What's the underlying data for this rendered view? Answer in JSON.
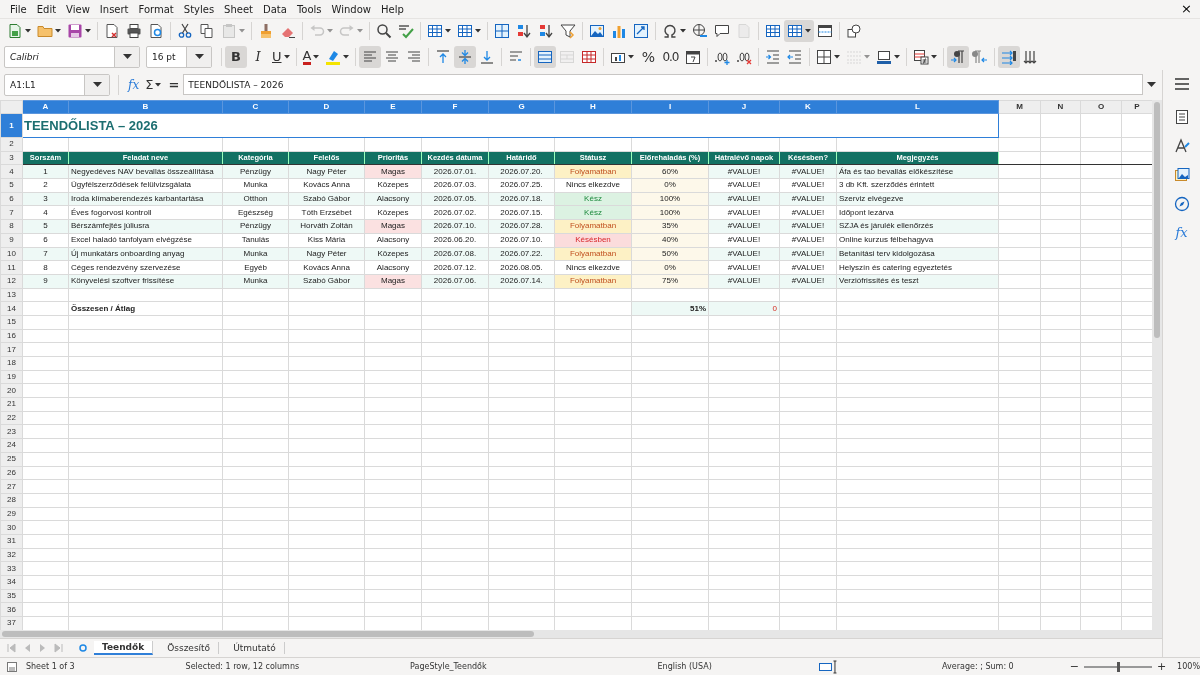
{
  "menu": [
    "File",
    "Edit",
    "View",
    "Insert",
    "Format",
    "Styles",
    "Sheet",
    "Data",
    "Tools",
    "Window",
    "Help"
  ],
  "close_document": "×",
  "standard_toolbar": [
    [
      {
        "kind": "new",
        "disabled": false,
        "on": false
      },
      {
        "kind": "open",
        "disabled": false,
        "on": false
      },
      {
        "kind": "save",
        "disabled": false,
        "on": false
      }
    ],
    [
      {
        "kind": "pdf",
        "disabled": false,
        "on": false
      },
      {
        "kind": "print",
        "disabled": false,
        "on": false
      },
      {
        "kind": "preview",
        "disabled": false,
        "on": false
      }
    ],
    [
      {
        "kind": "cut",
        "disabled": false,
        "on": false
      },
      {
        "kind": "copy",
        "disabled": false,
        "on": false
      },
      {
        "kind": "paste",
        "disabled": true,
        "on": false
      }
    ],
    [
      {
        "kind": "clone",
        "disabled": false,
        "on": false
      },
      {
        "kind": "clear",
        "disabled": false,
        "on": false
      }
    ],
    [
      {
        "kind": "undo",
        "disabled": true,
        "on": false
      },
      {
        "kind": "redo",
        "disabled": true,
        "on": false
      }
    ],
    [
      {
        "kind": "find",
        "disabled": false,
        "on": false
      },
      {
        "kind": "spell",
        "disabled": false,
        "on": false
      }
    ],
    [
      {
        "kind": "rows",
        "disabled": false,
        "on": false
      },
      {
        "kind": "columns",
        "disabled": false,
        "on": false
      }
    ],
    [
      {
        "kind": "sort",
        "disabled": false,
        "on": false
      },
      {
        "kind": "asc",
        "disabled": false,
        "on": false
      },
      {
        "kind": "desc",
        "disabled": false,
        "on": false
      },
      {
        "kind": "filter",
        "disabled": false,
        "on": false
      }
    ],
    [
      {
        "kind": "image",
        "disabled": false,
        "on": false
      },
      {
        "kind": "chart",
        "disabled": false,
        "on": false
      },
      {
        "kind": "pivot",
        "disabled": false,
        "on": false
      }
    ],
    [
      {
        "kind": "special",
        "disabled": false,
        "on": false
      },
      {
        "kind": "link",
        "disabled": false,
        "on": false
      },
      {
        "kind": "comment",
        "disabled": false,
        "on": false
      },
      {
        "kind": "headerfooter",
        "disabled": true,
        "on": false
      }
    ],
    [
      {
        "kind": "printarea",
        "disabled": false,
        "on": false
      },
      {
        "kind": "freeze",
        "disabled": false,
        "on": true
      },
      {
        "kind": "split",
        "disabled": false,
        "on": false
      }
    ],
    [
      {
        "kind": "draw",
        "disabled": false,
        "on": false
      }
    ]
  ],
  "formatting_toolbar": {
    "font_name": "Calibri",
    "font_size": "16 pt",
    "groups": [
      [
        {
          "kind": "bold",
          "label": "B",
          "disabled": false,
          "on": true
        },
        {
          "kind": "italic",
          "label": "I",
          "disabled": false,
          "on": false
        },
        {
          "kind": "underline",
          "label": "U",
          "disabled": false,
          "on": false
        }
      ],
      [
        {
          "kind": "fontcolor",
          "label": "A",
          "disabled": false,
          "on": false
        },
        {
          "kind": "highlight",
          "disabled": false,
          "on": false
        }
      ],
      [
        {
          "kind": "alignleft",
          "disabled": false,
          "on": true
        },
        {
          "kind": "aligncenter",
          "disabled": false,
          "on": false
        },
        {
          "kind": "alignright",
          "disabled": false,
          "on": false
        }
      ],
      [
        {
          "kind": "aligntop",
          "disabled": false,
          "on": false
        },
        {
          "kind": "alignmiddle",
          "disabled": false,
          "on": true
        },
        {
          "kind": "alignbottom",
          "disabled": false,
          "on": false
        }
      ],
      [
        {
          "kind": "wrap",
          "disabled": false,
          "on": false
        }
      ],
      [
        {
          "kind": "merge",
          "disabled": false,
          "on": true
        },
        {
          "kind": "unmerge",
          "disabled": true,
          "on": false
        },
        {
          "kind": "splitcells",
          "disabled": false,
          "on": false
        }
      ],
      [
        {
          "kind": "numberformat",
          "disabled": false,
          "on": false
        },
        {
          "kind": "percent",
          "label": "%",
          "disabled": false,
          "on": false
        },
        {
          "kind": "standard",
          "label": "0.0",
          "disabled": false,
          "on": false
        },
        {
          "kind": "date",
          "disabled": false,
          "on": false
        }
      ],
      [
        {
          "kind": "adddecimal",
          "disabled": false,
          "on": false
        },
        {
          "kind": "deldecimal",
          "disabled": false,
          "on": false
        }
      ],
      [
        {
          "kind": "indent",
          "disabled": false,
          "on": false
        },
        {
          "kind": "outdent",
          "disabled": false,
          "on": false
        }
      ],
      [
        {
          "kind": "borders",
          "disabled": false,
          "on": false
        },
        {
          "kind": "borderstyle",
          "disabled": true,
          "on": false
        },
        {
          "kind": "bordercolor",
          "disabled": false,
          "on": false
        }
      ],
      [
        {
          "kind": "conditional",
          "disabled": false,
          "on": false
        }
      ],
      [
        {
          "kind": "ltr",
          "disabled": false,
          "on": true
        },
        {
          "kind": "rtl",
          "disabled": false,
          "on": false
        }
      ],
      [
        {
          "kind": "textorient",
          "disabled": false,
          "on": true
        },
        {
          "kind": "verticaltext",
          "disabled": false,
          "on": false
        }
      ]
    ]
  },
  "formula_bar": {
    "name_box": "A1:L1",
    "function_wizard": "fx",
    "sum": "Σ",
    "equals": "=",
    "content": "TEENDŐLISTA – 2026"
  },
  "sidebar": {
    "functions": "fx"
  },
  "sheet": {
    "column_headers": [
      {
        "label": "A",
        "selected": true
      },
      {
        "label": "B",
        "selected": true
      },
      {
        "label": "C",
        "selected": true
      },
      {
        "label": "D",
        "selected": true
      },
      {
        "label": "E",
        "selected": true
      },
      {
        "label": "F",
        "selected": true
      },
      {
        "label": "G",
        "selected": true
      },
      {
        "label": "H",
        "selected": true
      },
      {
        "label": "I",
        "selected": true
      },
      {
        "label": "J",
        "selected": true
      },
      {
        "label": "K",
        "selected": true
      },
      {
        "label": "L",
        "selected": true
      },
      {
        "label": "M",
        "selected": false
      },
      {
        "label": "N",
        "selected": false
      },
      {
        "label": "O",
        "selected": false
      },
      {
        "label": "P",
        "selected": false
      }
    ],
    "row_numbers": [
      {
        "label": "1",
        "selected": true
      },
      {
        "label": "2",
        "selected": false
      },
      {
        "label": "3",
        "selected": false
      },
      {
        "label": "4",
        "selected": false
      },
      {
        "label": "5",
        "selected": false
      },
      {
        "label": "6",
        "selected": false
      },
      {
        "label": "7",
        "selected": false
      },
      {
        "label": "8",
        "selected": false
      },
      {
        "label": "9",
        "selected": false
      },
      {
        "label": "10",
        "selected": false
      },
      {
        "label": "11",
        "selected": false
      },
      {
        "label": "12",
        "selected": false
      },
      {
        "label": "13",
        "selected": false
      },
      {
        "label": "14",
        "selected": false
      },
      {
        "label": "15",
        "selected": false
      },
      {
        "label": "16",
        "selected": false
      },
      {
        "label": "17",
        "selected": false
      },
      {
        "label": "18",
        "selected": false
      },
      {
        "label": "19",
        "selected": false
      },
      {
        "label": "20",
        "selected": false
      },
      {
        "label": "21",
        "selected": false
      },
      {
        "label": "22",
        "selected": false
      },
      {
        "label": "23",
        "selected": false
      },
      {
        "label": "24",
        "selected": false
      },
      {
        "label": "25",
        "selected": false
      },
      {
        "label": "26",
        "selected": false
      },
      {
        "label": "27",
        "selected": false
      },
      {
        "label": "28",
        "selected": false
      },
      {
        "label": "29",
        "selected": false
      },
      {
        "label": "30",
        "selected": false
      },
      {
        "label": "31",
        "selected": false
      },
      {
        "label": "32",
        "selected": false
      },
      {
        "label": "33",
        "selected": false
      },
      {
        "label": "34",
        "selected": false
      },
      {
        "label": "35",
        "selected": false
      },
      {
        "label": "36",
        "selected": false
      },
      {
        "label": "37",
        "selected": false
      }
    ],
    "title": "TEENDŐLISTA – 2026",
    "table_header": [
      "Sorszám",
      "Feladat neve",
      "Kategória",
      "Felelős",
      "Prioritás",
      "Kezdés dátuma",
      "Határidő",
      "Státusz",
      "Előrehaladás (%)",
      "Hátralévő napok",
      "Késésben?",
      "Megjegyzés"
    ],
    "tasks": [
      {
        "no": "1",
        "task": "Negyedéves NAV bevallás összeállítása",
        "category": "Pénzügy",
        "owner": "Nagy Péter",
        "priority": {
          "text": "Magas",
          "kind": "high"
        },
        "start": "2026.07.01.",
        "due": "2026.07.20.",
        "status": {
          "text": "Folyamatban",
          "kind": "in_progress"
        },
        "progress": "60%",
        "days_left": "#VALUE!",
        "late": "#VALUE!",
        "note": "Áfa és tao bevallás előkészítése"
      },
      {
        "no": "2",
        "task": "Ügyfélszerződések felülvizsgálata",
        "category": "Munka",
        "owner": "Kovács Anna",
        "priority": {
          "text": "Közepes",
          "kind": "medium"
        },
        "start": "2026.07.03.",
        "due": "2026.07.25.",
        "status": {
          "text": "Nincs elkezdve",
          "kind": "not_started"
        },
        "progress": "0%",
        "days_left": "#VALUE!",
        "late": "#VALUE!",
        "note": "3 db Kft. szerződés érintett"
      },
      {
        "no": "3",
        "task": "Iroda klímaberendezés karbantartása",
        "category": "Otthon",
        "owner": "Szabó Gábor",
        "priority": {
          "text": "Alacsony",
          "kind": "low"
        },
        "start": "2026.07.05.",
        "due": "2026.07.18.",
        "status": {
          "text": "Kész",
          "kind": "done"
        },
        "progress": "100%",
        "days_left": "#VALUE!",
        "late": "#VALUE!",
        "note": "Szerviz elvégezve"
      },
      {
        "no": "4",
        "task": "Éves fogorvosi kontroll",
        "category": "Egészség",
        "owner": "Tóth Erzsébet",
        "priority": {
          "text": "Közepes",
          "kind": "medium"
        },
        "start": "2026.07.02.",
        "due": "2026.07.15.",
        "status": {
          "text": "Kész",
          "kind": "done"
        },
        "progress": "100%",
        "days_left": "#VALUE!",
        "late": "#VALUE!",
        "note": "Időpont lezárva"
      },
      {
        "no": "5",
        "task": "Bérszámfejtés júliusra",
        "category": "Pénzügy",
        "owner": "Horváth Zoltán",
        "priority": {
          "text": "Magas",
          "kind": "high"
        },
        "start": "2026.07.10.",
        "due": "2026.07.28.",
        "status": {
          "text": "Folyamatban",
          "kind": "in_progress"
        },
        "progress": "35%",
        "days_left": "#VALUE!",
        "late": "#VALUE!",
        "note": "SZJA és járulék ellenőrzés"
      },
      {
        "no": "6",
        "task": "Excel haladó tanfolyam elvégzése",
        "category": "Tanulás",
        "owner": "Kiss Mária",
        "priority": {
          "text": "Alacsony",
          "kind": "low"
        },
        "start": "2026.06.20.",
        "due": "2026.07.10.",
        "status": {
          "text": "Késésben",
          "kind": "late"
        },
        "progress": "40%",
        "days_left": "#VALUE!",
        "late": "#VALUE!",
        "note": "Online kurzus félbehagyva"
      },
      {
        "no": "7",
        "task": "Új munkatárs onboarding anyag",
        "category": "Munka",
        "owner": "Nagy Péter",
        "priority": {
          "text": "Közepes",
          "kind": "medium"
        },
        "start": "2026.07.08.",
        "due": "2026.07.22.",
        "status": {
          "text": "Folyamatban",
          "kind": "in_progress"
        },
        "progress": "50%",
        "days_left": "#VALUE!",
        "late": "#VALUE!",
        "note": "Betanítási terv kidolgozása"
      },
      {
        "no": "8",
        "task": "Céges rendezvény szervezése",
        "category": "Egyéb",
        "owner": "Kovács Anna",
        "priority": {
          "text": "Alacsony",
          "kind": "low"
        },
        "start": "2026.07.12.",
        "due": "2026.08.05.",
        "status": {
          "text": "Nincs elkezdve",
          "kind": "not_started"
        },
        "progress": "0%",
        "days_left": "#VALUE!",
        "late": "#VALUE!",
        "note": "Helyszín és catering egyeztetés"
      },
      {
        "no": "9",
        "task": "Könyvelési szoftver frissítése",
        "category": "Munka",
        "owner": "Szabó Gábor",
        "priority": {
          "text": "Magas",
          "kind": "high"
        },
        "start": "2026.07.06.",
        "due": "2026.07.14.",
        "status": {
          "text": "Folyamatban",
          "kind": "in_progress"
        },
        "progress": "75%",
        "days_left": "#VALUE!",
        "late": "#VALUE!",
        "note": "Verziófrissítés és teszt"
      }
    ],
    "totals": {
      "label": "Összesen / Átlag",
      "progress": "51%",
      "late_count": "0"
    }
  },
  "sheet_tabs": [
    {
      "label": "Teendők",
      "selected": true
    },
    {
      "label": "Összesítő",
      "selected": false
    },
    {
      "label": "Útmutató",
      "selected": false
    }
  ],
  "status_bar": {
    "sheet": "Sheet 1 of 3",
    "selection": "Selected: 1 row, 12 columns",
    "page_style": "PageStyle_Teendők",
    "language": "English (USA)",
    "summary": "Average: ; Sum: 0",
    "zoom": {
      "minus": "−",
      "plus": "+",
      "level": 0.5,
      "percent": "100%"
    }
  }
}
